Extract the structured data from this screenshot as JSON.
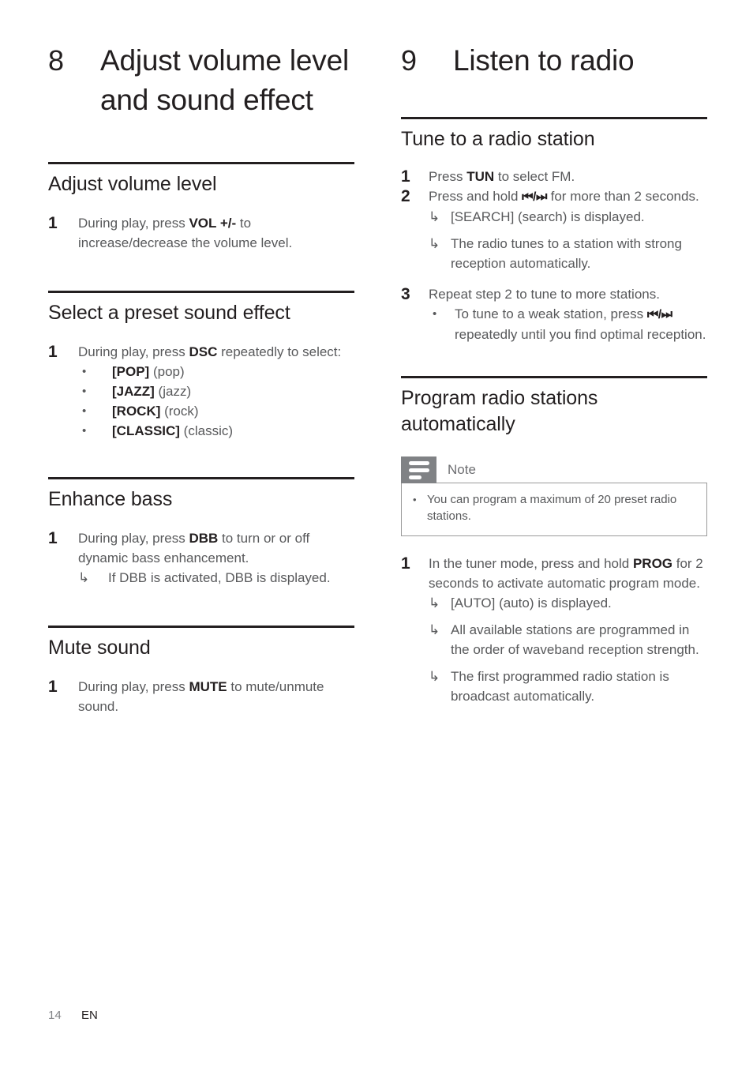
{
  "left_column": {
    "chapter": {
      "number": "8",
      "title": "Adjust volume level and sound effect"
    },
    "sections": [
      {
        "heading": "Adjust volume level",
        "steps": [
          {
            "number": "1",
            "text_1": "During play, press ",
            "keyword": "VOL +/-",
            "text_2": " to increase/decrease the volume level."
          }
        ]
      },
      {
        "heading": "Select a preset sound effect",
        "steps": [
          {
            "number": "1",
            "text_1": "During play, press ",
            "keyword": "DSC",
            "text_2": " repeatedly to select:"
          }
        ],
        "bullets": [
          {
            "mark": "•",
            "label": "[POP]",
            "note": " (pop)"
          },
          {
            "mark": "•",
            "label": "[JAZZ]",
            "note": " (jazz)"
          },
          {
            "mark": "•",
            "label": "[ROCK]",
            "note": " (rock)"
          },
          {
            "mark": "•",
            "label": "[CLASSIC]",
            "note": " (classic)"
          }
        ]
      },
      {
        "heading": "Enhance bass",
        "steps": [
          {
            "number": "1",
            "text_1": "During play, press ",
            "keyword": "DBB",
            "text_2": " to turn or or off dynamic bass enhancement."
          }
        ],
        "arrows": [
          {
            "mark": "↳",
            "text": "If DBB is activated, DBB is displayed."
          }
        ]
      },
      {
        "heading": "Mute sound",
        "steps": [
          {
            "number": "1",
            "text_1": "During play, press ",
            "keyword": "MUTE",
            "text_2": " to mute/unmute sound."
          }
        ]
      }
    ]
  },
  "right_column": {
    "chapter": {
      "number": "9",
      "title": "Listen to radio"
    },
    "section_tune": {
      "heading": "Tune to a radio station",
      "step1": {
        "number": "1",
        "text_1": "Press ",
        "keyword": "TUN",
        "text_2": " to select FM."
      },
      "step2": {
        "number": "2",
        "text_1": "Press and hold ",
        "glyph": "⏮⏭",
        "glyph_prev": "◀◀",
        "glyph_next": "▶▶",
        "text_2": " for more than 2 seconds."
      },
      "step2_arrows": [
        {
          "mark": "↳",
          "text": "[SEARCH] (search) is displayed."
        },
        {
          "mark": "↳",
          "text": "The radio tunes to a station with strong reception automatically."
        }
      ],
      "step3": {
        "number": "3",
        "text": "Repeat step 2 to tune to more stations."
      },
      "step3_bullet": {
        "mark": "•",
        "text_1": "To tune to a weak station, press ",
        "text_2": " repeatedly until you find optimal reception."
      }
    },
    "section_program": {
      "heading": "Program radio stations automatically",
      "note": {
        "title": "Note",
        "bullet_mark": "•",
        "text": "You can program a maximum of 20 preset radio stations.",
        "icon": "note-lines-icon",
        "tab_color": "#808285",
        "border_color": "#9a9a9a"
      },
      "step1": {
        "number": "1",
        "text_1": "In the tuner mode, press and hold ",
        "keyword": "PROG",
        "text_2": " for 2 seconds to activate automatic program mode."
      },
      "step1_arrows": [
        {
          "mark": "↳",
          "text": "[AUTO] (auto) is displayed."
        },
        {
          "mark": "↳",
          "text": "All available stations are programmed in the order of waveband reception strength."
        },
        {
          "mark": "↳",
          "text": "The first programmed radio station is broadcast automatically."
        }
      ]
    }
  },
  "footer": {
    "page_number": "14",
    "language": "EN"
  },
  "colors": {
    "heading": "#231f20",
    "body": "#58595b",
    "rule": "#231f20",
    "note_tab": "#808285"
  }
}
